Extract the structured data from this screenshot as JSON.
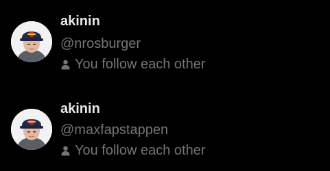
{
  "users": [
    {
      "display_name": "akinin",
      "handle": "@nrosburger",
      "follow_status": "You follow each other",
      "icon": "person-icon"
    },
    {
      "display_name": "akinin",
      "handle": "@maxfapstappen",
      "follow_status": "You follow each other",
      "icon": "person-icon"
    }
  ],
  "colors": {
    "background": "#000000",
    "name": "#e7e9ea",
    "secondary": "#71767b"
  }
}
